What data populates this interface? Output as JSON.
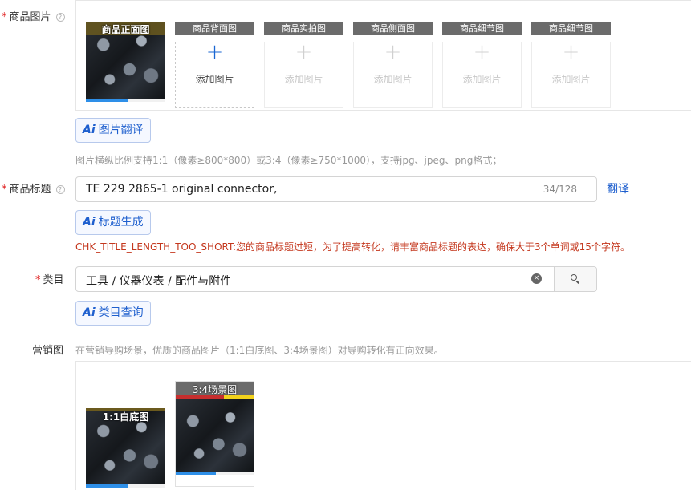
{
  "labels": {
    "required_mark": "*",
    "help_glyph": "?",
    "images": "商品图片",
    "title": "商品标题",
    "category": "类目",
    "marketing": "营销图"
  },
  "image_slots": [
    {
      "label": "商品正面图",
      "state": "uploaded"
    },
    {
      "label": "商品背面图",
      "state": "active",
      "add_text": "添加图片"
    },
    {
      "label": "商品实拍图",
      "state": "disabled",
      "add_text": "添加图片"
    },
    {
      "label": "商品侧面图",
      "state": "disabled",
      "add_text": "添加图片"
    },
    {
      "label": "商品细节图",
      "state": "disabled",
      "add_text": "添加图片"
    },
    {
      "label": "商品细节图",
      "state": "disabled",
      "add_text": "添加图片"
    }
  ],
  "plus_glyph": "+",
  "ai_glyph": "Ai",
  "image_translate_button": "图片翻译",
  "image_hint": "图片横纵比例支持1:1（像素≥800*800）或3:4（像素≥750*1000），支持jpg、jpeg、png格式；",
  "title_field": {
    "value": "TE 229 2865-1 original connector,",
    "counter": "34/128",
    "translate_link": "翻译",
    "generate_button": "标题生成",
    "error": "CHK_TITLE_LENGTH_TOO_SHORT:您的商品标题过短，为了提高转化，请丰富商品标题的表达，确保大于3个单词或15个字符。"
  },
  "category_field": {
    "value": "工具 / 仪器仪表 / 配件与附件",
    "clear_glyph": "×",
    "query_button": "类目查询"
  },
  "marketing": {
    "hint": "在营销导购场景，优质的商品图片（1:1白底图、3:4场景图）对导购转化有正向效果。",
    "images": [
      {
        "label": "1:1白底图"
      },
      {
        "label": "3:4场景图"
      }
    ]
  },
  "colors": {
    "accent": "#1e5fce",
    "required": "#e02020",
    "error": "#c4371d",
    "slot_header": "#6b6b6b"
  }
}
